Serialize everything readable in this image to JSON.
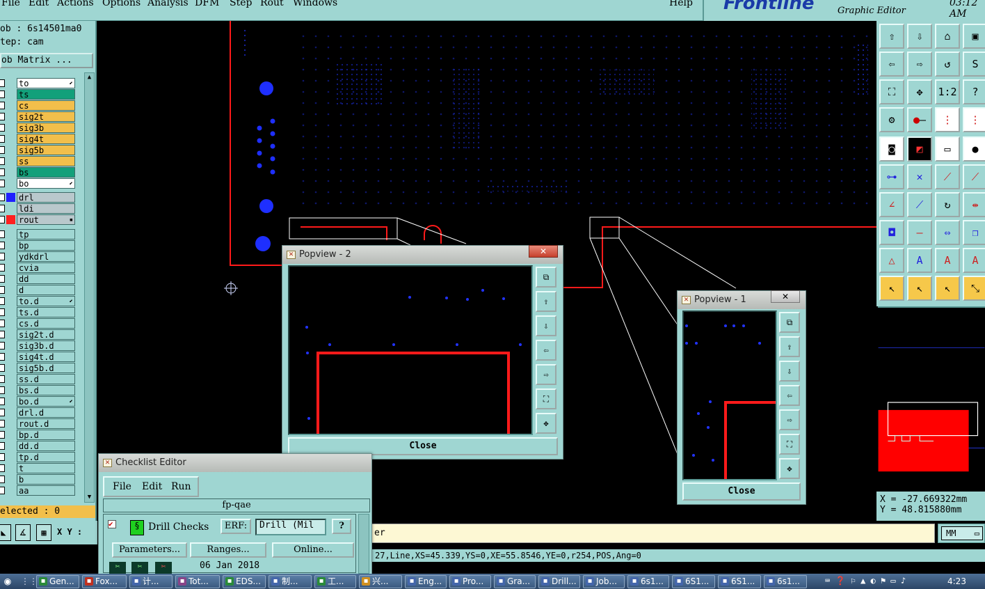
{
  "menu": {
    "items": [
      "File",
      "Edit",
      "Actions",
      "Options",
      "Analysis",
      "DFM",
      "Step",
      "Rout",
      "Windows"
    ],
    "help": "Help"
  },
  "brand": {
    "logo": "Frontline",
    "subtitle": "Graphic Editor",
    "time": "03:12  AM"
  },
  "job": {
    "job_line": "ob : 6s14501ma0",
    "step_line": "tep: cam",
    "matrix_button": "ob Matrix ...",
    "selected": "elected : 0"
  },
  "layers": [
    {
      "name": "to",
      "color": "#ffffff",
      "flag": "⬋"
    },
    {
      "name": "ts",
      "color": "#12a07a"
    },
    {
      "name": "cs",
      "color": "#f2bf4b"
    },
    {
      "name": "sig2t",
      "color": "#f2bf4b"
    },
    {
      "name": "sig3b",
      "color": "#f2bf4b"
    },
    {
      "name": "sig4t",
      "color": "#f2bf4b"
    },
    {
      "name": "sig5b",
      "color": "#f2bf4b"
    },
    {
      "name": "ss",
      "color": "#f2bf4b"
    },
    {
      "name": "bs",
      "color": "#12a07a"
    },
    {
      "name": "bo",
      "color": "#ffffff",
      "flag": "⬋"
    },
    {
      "name": "drl",
      "color": "#b9c8cc",
      "swatch": "#2020ff"
    },
    {
      "name": "ldi",
      "color": "#b9c8cc"
    },
    {
      "name": "rout",
      "color": "#b9c8cc",
      "swatch": "#ff2020",
      "flag": "▪"
    },
    {
      "name": "tp",
      "color": "#9fd6d2"
    },
    {
      "name": "bp",
      "color": "#9fd6d2"
    },
    {
      "name": "ydkdrl",
      "color": "#9fd6d2"
    },
    {
      "name": "cvia",
      "color": "#9fd6d2"
    },
    {
      "name": "dd",
      "color": "#9fd6d2"
    },
    {
      "name": "d",
      "color": "#9fd6d2"
    },
    {
      "name": "to.d",
      "color": "#9fd6d2",
      "flag": "⬋"
    },
    {
      "name": "ts.d",
      "color": "#9fd6d2"
    },
    {
      "name": "cs.d",
      "color": "#9fd6d2"
    },
    {
      "name": "sig2t.d",
      "color": "#9fd6d2"
    },
    {
      "name": "sig3b.d",
      "color": "#9fd6d2"
    },
    {
      "name": "sig4t.d",
      "color": "#9fd6d2"
    },
    {
      "name": "sig5b.d",
      "color": "#9fd6d2"
    },
    {
      "name": "ss.d",
      "color": "#9fd6d2"
    },
    {
      "name": "bs.d",
      "color": "#9fd6d2"
    },
    {
      "name": "bo.d",
      "color": "#9fd6d2",
      "flag": "⬋"
    },
    {
      "name": "drl.d",
      "color": "#9fd6d2"
    },
    {
      "name": "rout.d",
      "color": "#9fd6d2"
    },
    {
      "name": "bp.d",
      "color": "#9fd6d2"
    },
    {
      "name": "dd.d",
      "color": "#9fd6d2"
    },
    {
      "name": "tp.d",
      "color": "#9fd6d2"
    },
    {
      "name": "t",
      "color": "#9fd6d2"
    },
    {
      "name": "b",
      "color": "#9fd6d2"
    },
    {
      "name": "aa",
      "color": "#9fd6d2"
    }
  ],
  "bottom": {
    "xy_label": "X Y :",
    "message": "er",
    "unit": "MM",
    "status": "27,Line,XS=45.339,YS=0,XE=55.8546,YE=0,r254,POS,Ang=0"
  },
  "coords": {
    "x": "X = -27.669322mm",
    "y": "Y =  48.815880mm"
  },
  "popview2": {
    "title": "Popview - 2",
    "close_x": "✕",
    "close_label": "Close"
  },
  "popview1": {
    "title": "Popview - 1",
    "close_x": "✕",
    "close_label": "Close"
  },
  "checklist": {
    "title": "Checklist Editor",
    "menu": [
      "File",
      "Edit",
      "Run"
    ],
    "name": "fp-qae",
    "check_label": "Drill Checks",
    "erf_label": "ERF:",
    "erf_value": "Drill (Mil",
    "help": "?",
    "params_btn": "Parameters...",
    "ranges_btn": "Ranges...",
    "online_btn": "Online...",
    "date": "06 Jan 2018"
  },
  "taskbar": {
    "tasks": [
      "Gen...",
      "Fox...",
      "计...",
      "Tot...",
      "EDS...",
      "制...",
      "工...",
      "兴...",
      "Eng...",
      "Pro...",
      "Gra...",
      "Drill...",
      "Job...",
      "6s1...",
      "6S1...",
      "6S1...",
      "6s1..."
    ],
    "clock": "4:23"
  }
}
